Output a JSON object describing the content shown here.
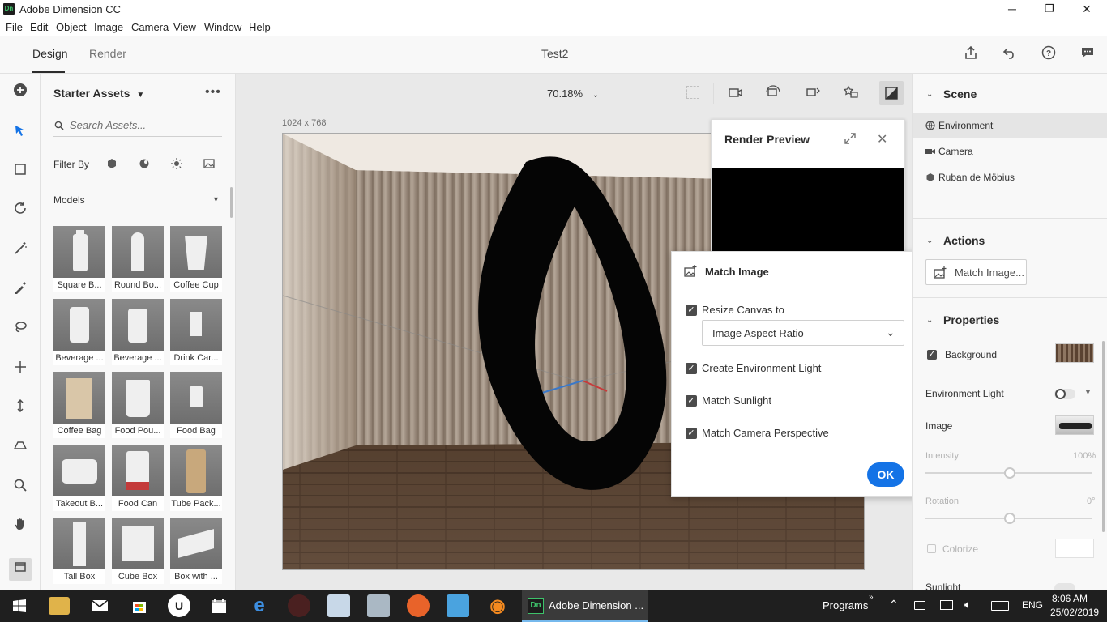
{
  "window": {
    "app_badge": "Dn",
    "title": "Adobe Dimension CC",
    "minimize": "─",
    "maximize": "❐",
    "close": "✕"
  },
  "menu": [
    "File",
    "Edit",
    "Object",
    "Image",
    "Camera",
    "View",
    "Window",
    "Help"
  ],
  "header": {
    "tab_design": "Design",
    "tab_render": "Render",
    "doc_title": "Test2"
  },
  "assets": {
    "title": "Starter Assets",
    "search_placeholder": "Search Assets...",
    "filter_label": "Filter By",
    "section_label": "Models",
    "models": [
      "Square B...",
      "Round Bo...",
      "Coffee Cup",
      "Beverage ...",
      "Beverage ...",
      "Drink Car...",
      "Coffee Bag",
      "Food Pou...",
      "Food Bag",
      "Takeout B...",
      "Food Can",
      "Tube Pack...",
      "Tall Box",
      "Cube Box",
      "Box with ..."
    ]
  },
  "canvas": {
    "zoom": "70.18%",
    "size_label": "1024 x 768"
  },
  "render_preview": {
    "title": "Render Preview"
  },
  "match_image": {
    "title": "Match Image",
    "resize_label": "Resize Canvas to",
    "resize_value": "Image Aspect Ratio",
    "env_light_label": "Create Environment Light",
    "sunlight_label": "Match Sunlight",
    "camera_label": "Match Camera Perspective",
    "ok_label": "OK"
  },
  "right_panel": {
    "scene_title": "Scene",
    "scene_items": [
      "Environment",
      "Camera",
      "Ruban de Möbius"
    ],
    "actions_title": "Actions",
    "match_button": "Match Image...",
    "properties_title": "Properties",
    "background_label": "Background",
    "env_light_label": "Environment Light",
    "image_label": "Image",
    "intensity_label": "Intensity",
    "intensity_value": "100%",
    "rotation_label": "Rotation",
    "rotation_value": "0°",
    "colorize_label": "Colorize",
    "sunlight_label": "Sunlight"
  },
  "taskbar": {
    "active_app": "Adobe Dimension ...",
    "programs_label": "Programs",
    "lang": "ENG",
    "time": "8:06 AM",
    "date": "25/02/2019"
  },
  "colors": {
    "accent": "#1473e6",
    "ok_button": "#1473e6",
    "taskbar": "#1f1f1f"
  }
}
